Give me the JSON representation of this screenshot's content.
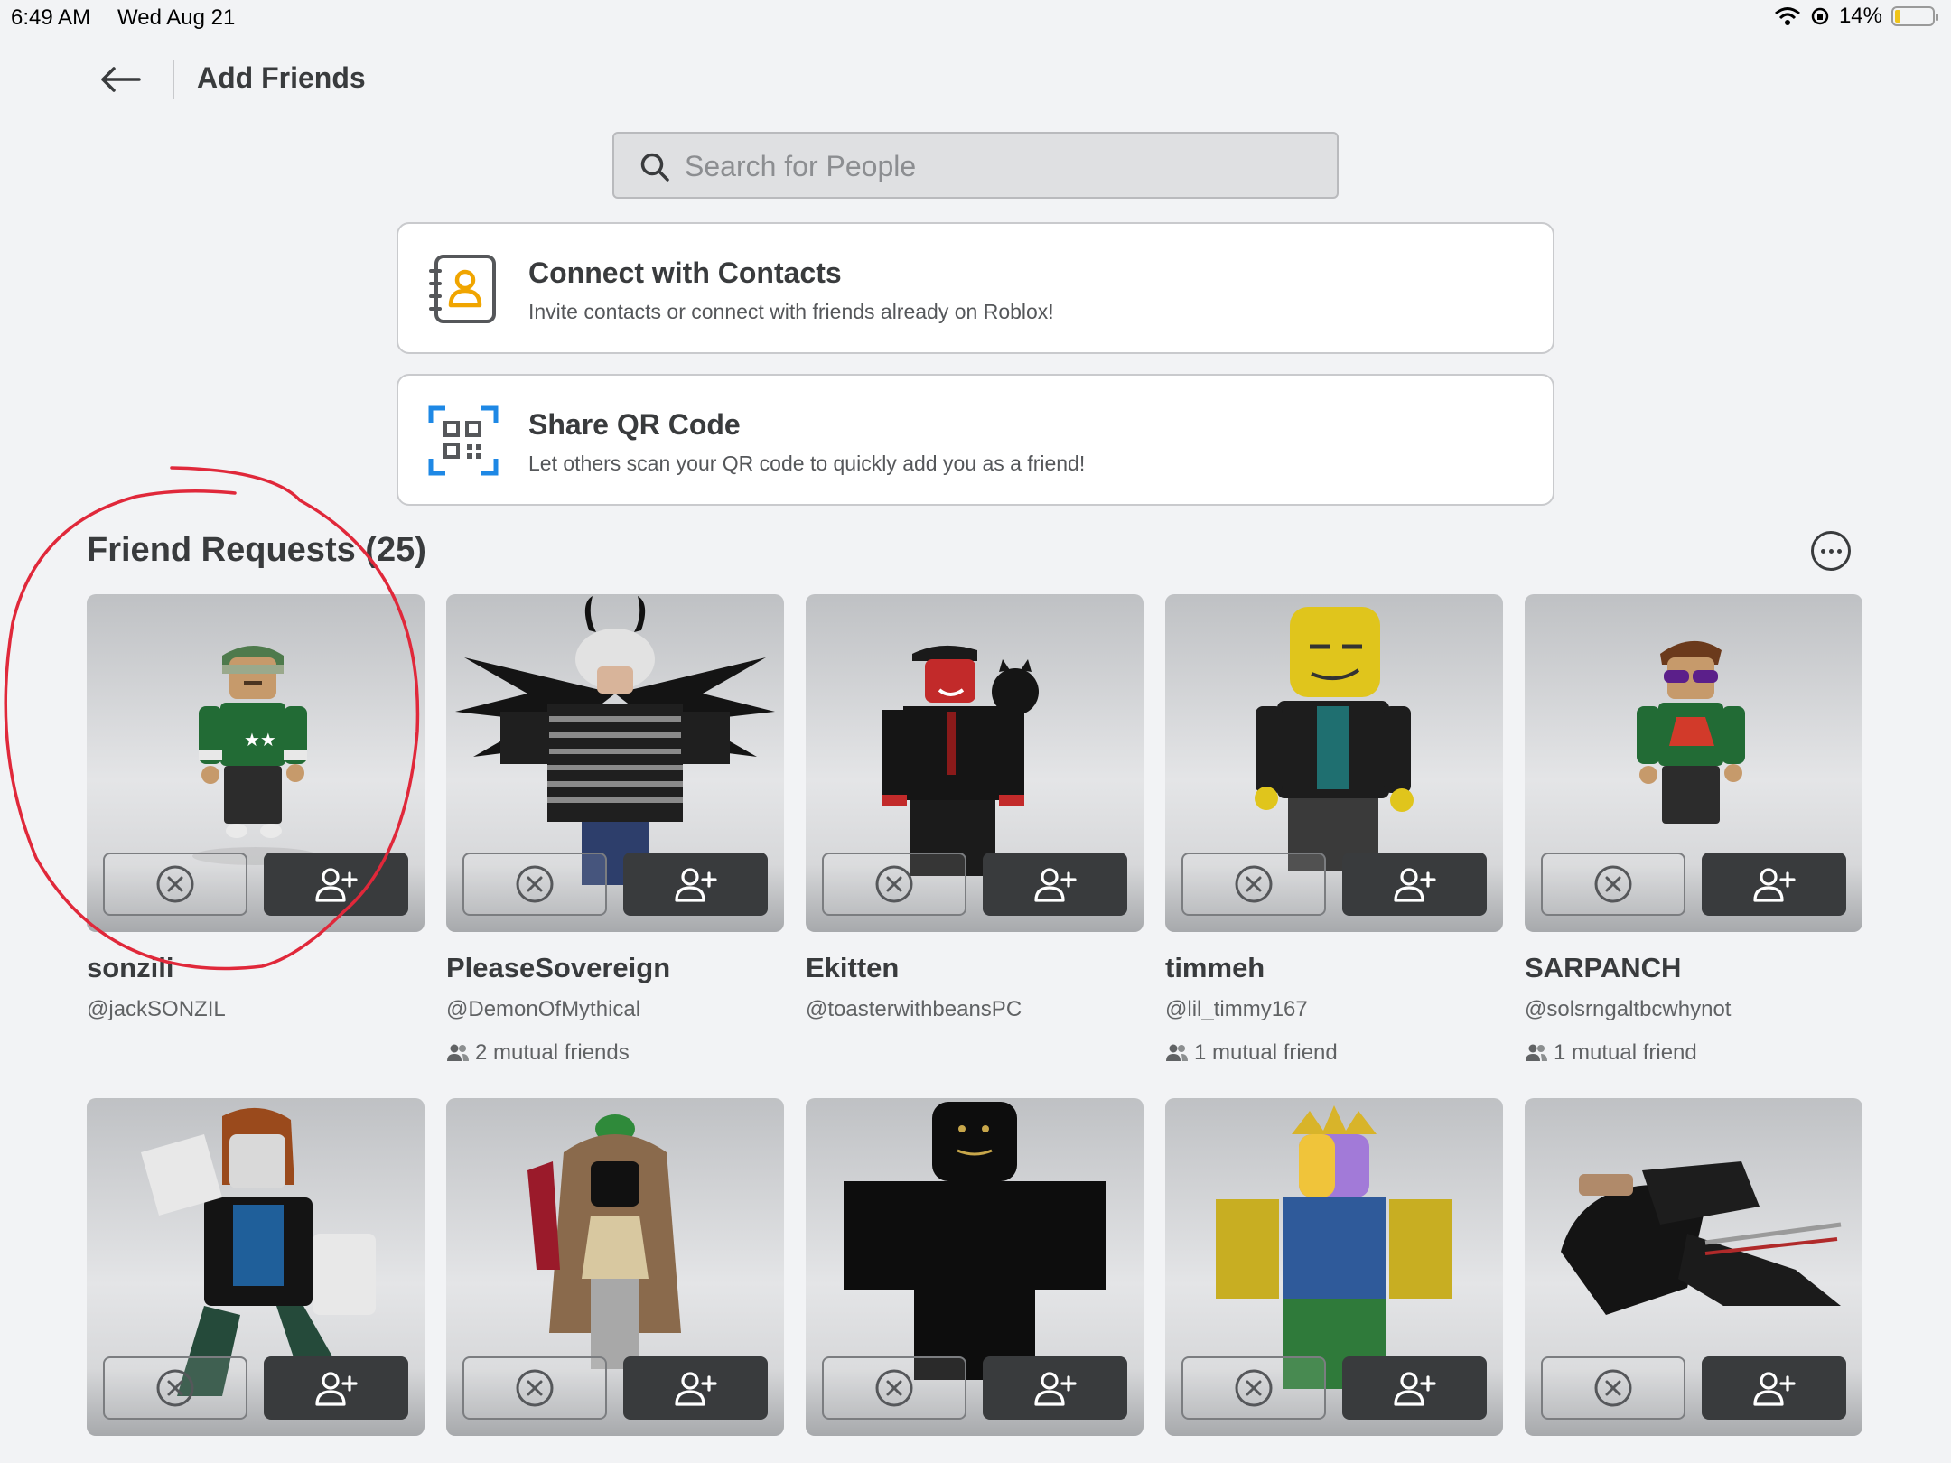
{
  "status_bar": {
    "time": "6:49 AM",
    "date": "Wed Aug 21",
    "battery": "14%",
    "battery_level": 0.14
  },
  "header": {
    "title": "Add Friends"
  },
  "search": {
    "placeholder": "Search for People"
  },
  "options": [
    {
      "title": "Connect with Contacts",
      "subtitle": "Invite contacts or connect with friends already on Roblox!",
      "icon": "contacts-book-icon"
    },
    {
      "title": "Share QR Code",
      "subtitle": "Let others scan your QR code to quickly add you as a friend!",
      "icon": "qr-code-icon"
    }
  ],
  "friend_requests": {
    "title": "Friend Requests (25)",
    "items": [
      {
        "display_name": "sonzili",
        "username": "@jackSONZIL",
        "mutual": ""
      },
      {
        "display_name": "PleaseSovereign",
        "username": "@DemonOfMythical",
        "mutual": "2 mutual friends"
      },
      {
        "display_name": "Ekitten",
        "username": "@toasterwithbeansPC",
        "mutual": ""
      },
      {
        "display_name": "timmeh",
        "username": "@lil_timmy167",
        "mutual": "1 mutual friend"
      },
      {
        "display_name": "SARPANCH",
        "username": "@solsrngaltbcwhynot",
        "mutual": "1 mutual friend"
      }
    ]
  },
  "colors": {
    "accept_button": "#393b3d",
    "annotation": "#e0283a",
    "qr_icon": "#1e88e5",
    "contacts_icon": "#f0a500"
  }
}
